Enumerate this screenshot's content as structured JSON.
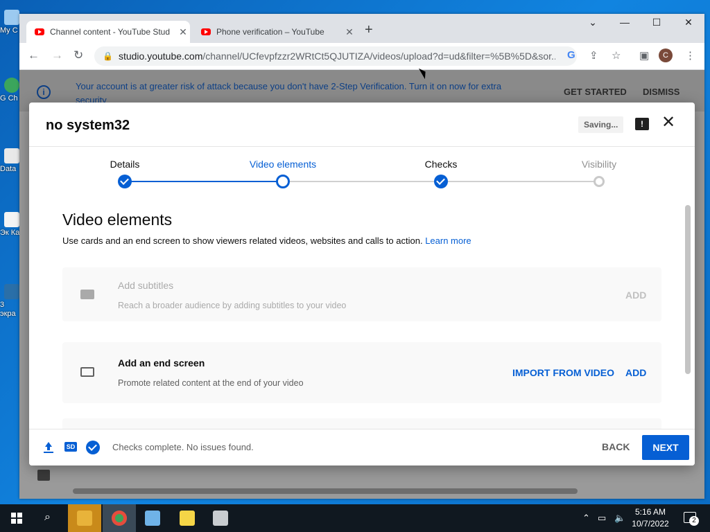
{
  "browser": {
    "tabs": [
      {
        "title": "Channel content - YouTube Stud",
        "active": true
      },
      {
        "title": "Phone verification – YouTube",
        "active": false
      }
    ],
    "url_host": "studio.youtube.com",
    "url_rest": "/channel/UCfevpfzzr2WRtCt5QJUTIZA/videos/upload?d=ud&filter=%5B%5D&sor...",
    "profile_initial": "C"
  },
  "banner": {
    "message": "Your account is at greater risk of attack because you don't have 2-Step Verification. Turn it on now for extra security",
    "get_started": "GET STARTED",
    "dismiss": "DISMISS"
  },
  "dialog": {
    "title": "no system32",
    "saving": "Saving...",
    "steps": [
      {
        "label": "Details",
        "state": "done"
      },
      {
        "label": "Video elements",
        "state": "current"
      },
      {
        "label": "Checks",
        "state": "done"
      },
      {
        "label": "Visibility",
        "state": "todo"
      }
    ],
    "section_title": "Video elements",
    "section_desc": "Use cards and an end screen to show viewers related videos, websites and calls to action.",
    "learn_more": "Learn more",
    "cards": [
      {
        "title": "Add subtitles",
        "desc": "Reach a broader audience by adding subtitles to your video",
        "action": "ADD",
        "disabled": true
      },
      {
        "title": "Add an end screen",
        "desc": "Promote related content at the end of your video",
        "import": "IMPORT FROM VIDEO",
        "action": "ADD",
        "disabled": false
      }
    ],
    "footer_status": "Checks complete. No issues found.",
    "back": "BACK",
    "next": "NEXT",
    "hd_badge": "SD"
  },
  "desktop_icons": [
    {
      "label": "My C"
    },
    {
      "label": "G Ch"
    },
    {
      "label": "Data"
    },
    {
      "label": "Эк Ка"
    },
    {
      "label": "3 экра"
    }
  ],
  "taskbar": {
    "time": "5:16 AM",
    "date": "10/7/2022",
    "notifications": "2"
  },
  "colors": {
    "accent": "#065fd4",
    "youtube_red": "#ff0000",
    "desktop_blue": "#1184e0"
  }
}
